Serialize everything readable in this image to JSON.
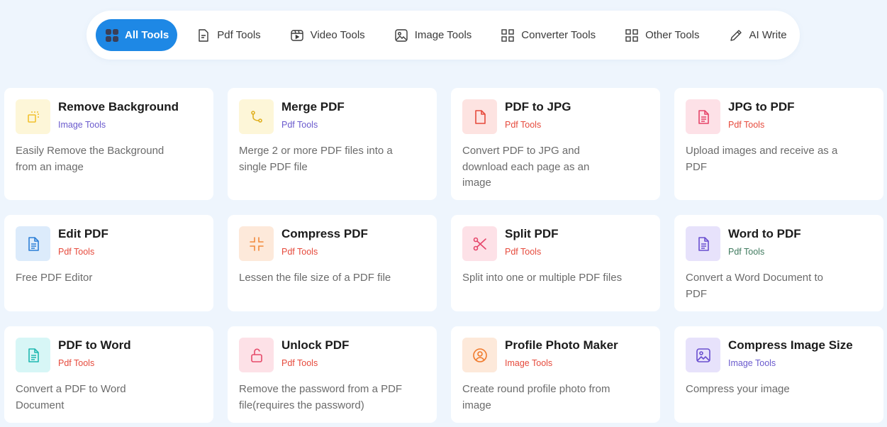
{
  "tabs": [
    {
      "label": "All Tools",
      "icon": "grid-dots-icon",
      "active": true
    },
    {
      "label": "Pdf Tools",
      "icon": "pdf-doc-icon",
      "active": false
    },
    {
      "label": "Video Tools",
      "icon": "video-icon",
      "active": false
    },
    {
      "label": "Image Tools",
      "icon": "image-icon",
      "active": false
    },
    {
      "label": "Converter Tools",
      "icon": "grid-icon",
      "active": false
    },
    {
      "label": "Other Tools",
      "icon": "grid-icon",
      "active": false
    },
    {
      "label": "AI Write",
      "icon": "pencil-icon",
      "active": false
    }
  ],
  "colors": {
    "accent": "#1e88e5",
    "background": "#eef5fd",
    "image_tools": "#6a5acd",
    "pdf_tools": "#e64a3c",
    "word_pdf_tools": "#3f7a5e"
  },
  "cards": [
    {
      "title": "Remove Background",
      "category": "Image Tools",
      "description": "Easily Remove the Background from an image",
      "icon": "crop-icon",
      "icon_color": "#f2c12e",
      "icon_bg": "#fdf6d8",
      "cat_color": "#6a5acd"
    },
    {
      "title": "Merge PDF",
      "category": "Pdf Tools",
      "description": "Merge 2 or more PDF files into a single PDF file",
      "icon": "merge-icon",
      "icon_color": "#e0b020",
      "icon_bg": "#fdf6d8",
      "cat_color": "#6a5acd"
    },
    {
      "title": "PDF to JPG",
      "category": "Pdf Tools",
      "description": "Convert PDF to JPG and download each page as an image",
      "icon": "file-icon",
      "icon_color": "#e64a3c",
      "icon_bg": "#fde3e1",
      "cat_color": "#e64a3c"
    },
    {
      "title": "JPG to PDF",
      "category": "Pdf Tools",
      "description": "Upload images and receive as a PDF",
      "icon": "file-text-icon",
      "icon_color": "#e6456a",
      "icon_bg": "#fde1e7",
      "cat_color": "#e64a3c"
    },
    {
      "title": "Edit PDF",
      "category": "Pdf Tools",
      "description": "Free PDF Editor",
      "icon": "file-text-icon",
      "icon_color": "#2d7fd6",
      "icon_bg": "#dcebfb",
      "cat_color": "#e64a3c"
    },
    {
      "title": "Compress PDF",
      "category": "Pdf Tools",
      "description": "Lessen the file size of a PDF file",
      "icon": "compress-icon",
      "icon_color": "#f28a3c",
      "icon_bg": "#fde9da",
      "cat_color": "#e64a3c"
    },
    {
      "title": "Split PDF",
      "category": "Pdf Tools",
      "description": "Split into one or multiple PDF files",
      "icon": "scissors-icon",
      "icon_color": "#e6456a",
      "icon_bg": "#fde1e7",
      "cat_color": "#e64a3c"
    },
    {
      "title": "Word to PDF",
      "category": "Pdf Tools",
      "description": "Convert a Word Document to PDF",
      "icon": "file-text-icon",
      "icon_color": "#6a4fd0",
      "icon_bg": "#e7e2fb",
      "cat_color": "#3f7a5e"
    },
    {
      "title": "PDF to Word",
      "category": "Pdf Tools",
      "description": "Convert a PDF to Word Document",
      "icon": "file-text-icon",
      "icon_color": "#1fb8b0",
      "icon_bg": "#d7f6f6",
      "cat_color": "#e64a3c"
    },
    {
      "title": "Unlock PDF",
      "category": "Pdf Tools",
      "description": "Remove the password from a PDF file(requires the password)",
      "icon": "unlock-icon",
      "icon_color": "#e64a6a",
      "icon_bg": "#fde1e7",
      "cat_color": "#e64a3c"
    },
    {
      "title": "Profile Photo Maker",
      "category": "Image Tools",
      "description": "Create round profile photo from image",
      "icon": "user-circle-icon",
      "icon_color": "#f07a2c",
      "icon_bg": "#fde9da",
      "cat_color": "#e64a3c"
    },
    {
      "title": "Compress Image Size",
      "category": "Image Tools",
      "description": "Compress your image",
      "icon": "image-icon",
      "icon_color": "#6a4fd0",
      "icon_bg": "#e7e2fb",
      "cat_color": "#6a5acd"
    }
  ]
}
